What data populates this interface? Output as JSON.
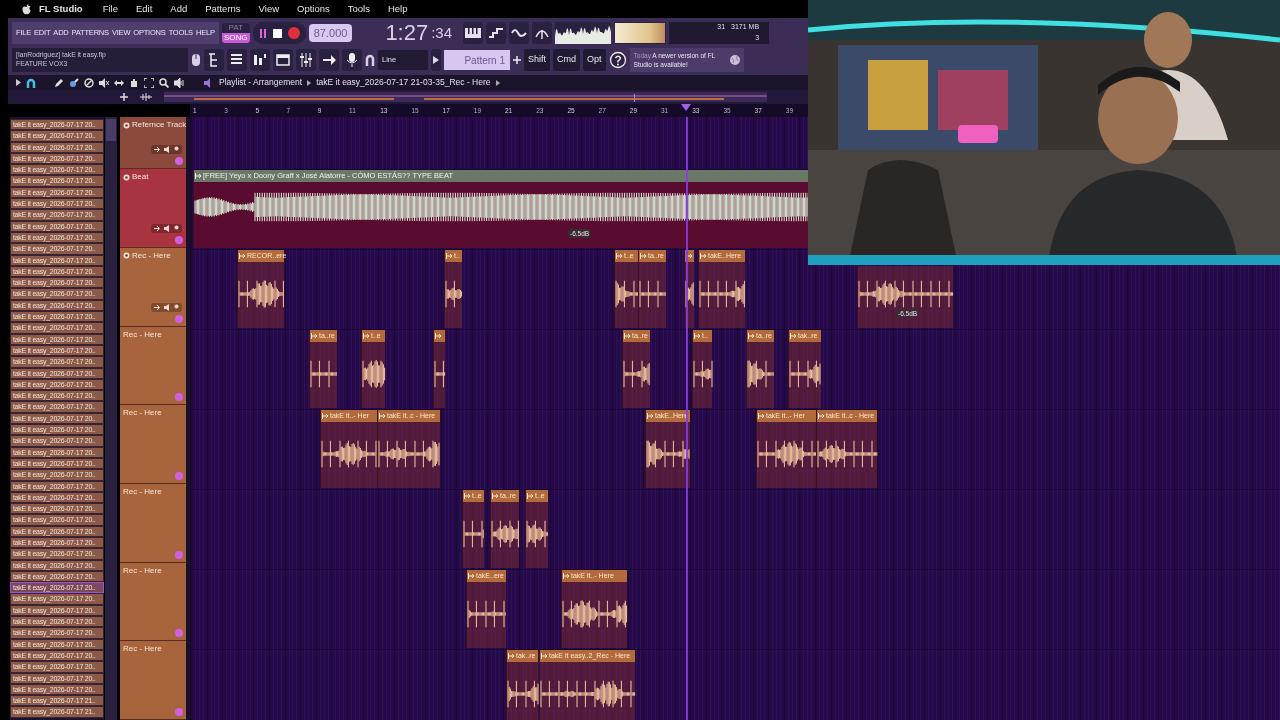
{
  "menubar": {
    "app": "FL Studio",
    "items": [
      "File",
      "Edit",
      "Add",
      "Patterns",
      "View",
      "Options",
      "Tools",
      "Help"
    ]
  },
  "toolbar": {
    "menus": [
      "FILE",
      "EDIT",
      "ADD",
      "PATTERNS",
      "VIEW",
      "OPTIONS",
      "TOOLS",
      "HELP"
    ],
    "modes": [
      {
        "label": "PAT",
        "selected": false
      },
      {
        "label": "SONG",
        "selected": true
      }
    ],
    "tempo": "87.000",
    "time_main": "1:27",
    "time_sub": ":34",
    "cpu": "31",
    "memory": "3171 MB",
    "polyphony": "3",
    "hint": [
      "[IanRodriguez] takE it easy.flp",
      "FEATURE VOX3"
    ],
    "snap": "Line",
    "pattern": "Pattern 1",
    "keys": [
      "Shift",
      "Cmd",
      "Opt"
    ],
    "news": {
      "date": "Today",
      "text": "A newer version of FL Studio is available!"
    }
  },
  "playlist": {
    "title": "Playlist - Arrangement",
    "path": "takE it easy_2026-07-17 21-03-35_Rec - Here",
    "ruler": [
      "1",
      "3",
      "5",
      "7",
      "9",
      "11",
      "13",
      "15",
      "17",
      "19",
      "21",
      "23",
      "25",
      "27",
      "29",
      "31",
      "33",
      "35",
      "37",
      "39"
    ],
    "browser": [
      {
        "text": "takE it easy_2026-07-17 20..",
        "selected": false
      },
      {
        "text": "takE it easy_2026-07-17 20..",
        "selected": false
      },
      {
        "text": "takE it easy_2026-07-17 20..",
        "selected": false
      },
      {
        "text": "takE it easy_2026-07-17 20..",
        "selected": false
      },
      {
        "text": "takE it easy_2026-07-17 20..",
        "selected": false
      },
      {
        "text": "takE it easy_2026-07-17 20..",
        "selected": false
      },
      {
        "text": "takE it easy_2026-07-17 20..",
        "selected": false
      },
      {
        "text": "takE it easy_2026-07-17 20..",
        "selected": false
      },
      {
        "text": "takE it easy_2026-07-17 20..",
        "selected": false
      },
      {
        "text": "takE it easy_2026-07-17 20..",
        "selected": false
      },
      {
        "text": "takE it easy_2026-07-17 20..",
        "selected": false
      },
      {
        "text": "takE it easy_2026-07-17 20..",
        "selected": false
      },
      {
        "text": "takE it easy_2026-07-17 20..",
        "selected": false
      },
      {
        "text": "takE it easy_2026-07-17 20..",
        "selected": false
      },
      {
        "text": "takE it easy_2026-07-17 20..",
        "selected": false
      },
      {
        "text": "takE it easy_2026-07-17 20..",
        "selected": false
      },
      {
        "text": "takE it easy_2026-07-17 20..",
        "selected": false
      },
      {
        "text": "takE it easy_2026-07-17 20..",
        "selected": false
      },
      {
        "text": "takE it easy_2026-07-17 20..",
        "selected": false
      },
      {
        "text": "takE it easy_2026-07-17 20..",
        "selected": false
      },
      {
        "text": "takE it easy_2026-07-17 20..",
        "selected": false
      },
      {
        "text": "takE it easy_2026-07-17 20..",
        "selected": false
      },
      {
        "text": "takE it easy_2026-07-17 20..",
        "selected": false
      },
      {
        "text": "takE it easy_2026-07-17 20..",
        "selected": false
      },
      {
        "text": "takE it easy_2026-07-17 20..",
        "selected": false
      },
      {
        "text": "takE it easy_2026-07-17 20..",
        "selected": false
      },
      {
        "text": "takE it easy_2026-07-17 20..",
        "selected": false
      },
      {
        "text": "takE it easy_2026-07-17 20..",
        "selected": false
      },
      {
        "text": "takE it easy_2026-07-17 20..",
        "selected": false
      },
      {
        "text": "takE it easy_2026-07-17 20..",
        "selected": false
      },
      {
        "text": "takE it easy_2026-07-17 20..",
        "selected": false
      },
      {
        "text": "takE it easy_2026-07-17 20..",
        "selected": false
      },
      {
        "text": "takE it easy_2026-07-17 20..",
        "selected": false
      },
      {
        "text": "takE it easy_2026-07-17 20..",
        "selected": false
      },
      {
        "text": "takE it easy_2026-07-17 20..",
        "selected": false
      },
      {
        "text": "takE it easy_2026-07-17 20..",
        "selected": false
      },
      {
        "text": "takE it easy_2026-07-17 20..",
        "selected": false
      },
      {
        "text": "takE it easy_2026-07-17 20..",
        "selected": false
      },
      {
        "text": "takE it easy_2026-07-17 20..",
        "selected": false
      },
      {
        "text": "takE it easy_2026-07-17 20..",
        "selected": false
      },
      {
        "text": "takE it easy_2026-07-17 20..",
        "selected": false
      },
      {
        "text": "takE it easy_2026-07-17 20..",
        "selected": true
      },
      {
        "text": "takE it easy_2026-07-17 20..",
        "selected": false
      },
      {
        "text": "takE it easy_2026-07-17 20..",
        "selected": false
      },
      {
        "text": "takE it easy_2026-07-17 20..",
        "selected": false
      },
      {
        "text": "takE it easy_2026-07-17 20..",
        "selected": false
      },
      {
        "text": "takE it easy_2026-07-17 20..",
        "selected": false
      },
      {
        "text": "takE it easy_2026-07-17 20..",
        "selected": false
      },
      {
        "text": "takE it easy_2026-07-17 20..",
        "selected": false
      },
      {
        "text": "takE it easy_2026-07-17 20..",
        "selected": false
      },
      {
        "text": "takE it easy_2026-07-17 20..",
        "selected": false
      },
      {
        "text": "takE it easy_2026-07-17 21..",
        "selected": false
      },
      {
        "text": "takE it easy_2026-07-17 21..",
        "selected": false
      }
    ],
    "tracks": [
      {
        "name": "Refernce Track",
        "color": "#8b4a3c",
        "controls": true
      },
      {
        "name": "Beat",
        "color": "#a8343f",
        "controls": true,
        "clips": [
          {
            "kind": "beat",
            "label": "[FREE] Yeyo x Doony Graff x José Alatorre - CÓMO ESTÁS??  TYPE BEAT",
            "gain": "-6.5dB"
          }
        ]
      },
      {
        "name": "Rec - Here",
        "color": "#a8643c",
        "controls": true,
        "clips": [
          {
            "kind": "rec",
            "label": "RECOR..ere"
          },
          {
            "kind": "rec",
            "label": "t.."
          },
          {
            "kind": "rec",
            "label": "t..e"
          },
          {
            "kind": "rec",
            "label": "ta..re"
          },
          {
            "kind": "rec"
          },
          {
            "kind": "rec",
            "label": "takE..Here"
          },
          {
            "kind": "rec",
            "gain": "-6.5dB"
          }
        ]
      },
      {
        "name": "Rec - Here",
        "color": "#a8643c",
        "controls": false,
        "clips": [
          {
            "kind": "rec",
            "label": "ta..re"
          },
          {
            "kind": "rec",
            "label": "t..e"
          },
          {
            "kind": "rec"
          },
          {
            "kind": "rec",
            "label": "ta..re"
          },
          {
            "kind": "rec",
            "label": "t.."
          },
          {
            "kind": "rec",
            "label": "ta..re"
          },
          {
            "kind": "rec",
            "label": "tak..re"
          }
        ]
      },
      {
        "name": "Rec - Here",
        "color": "#a8643c",
        "controls": false,
        "clips": [
          {
            "kind": "rec",
            "label": "takE it..- Her"
          },
          {
            "kind": "rec",
            "label": "takE it..c - Here"
          },
          {
            "kind": "rec",
            "label": "takE..Here"
          },
          {
            "kind": "rec",
            "label": "takE it..- Her"
          },
          {
            "kind": "rec",
            "label": "takE it..c - Here"
          }
        ]
      },
      {
        "name": "Rec - Here",
        "color": "#a8643c",
        "controls": false,
        "clips": [
          {
            "kind": "rec",
            "label": "t..e"
          },
          {
            "kind": "rec",
            "label": "ta..re"
          },
          {
            "kind": "rec",
            "label": "t..e"
          }
        ]
      },
      {
        "name": "Rec - Here",
        "color": "#a8643c",
        "controls": false,
        "clips": [
          {
            "kind": "rec",
            "label": "takE..ere"
          },
          {
            "kind": "rec",
            "label": "takE it..- Here"
          }
        ]
      },
      {
        "name": "Rec - Here",
        "color": "#a8643c",
        "controls": false,
        "clips": [
          {
            "kind": "rec",
            "label": "tak..re"
          },
          {
            "kind": "rec",
            "label": "takE it easy..2_Rec - Here"
          }
        ]
      }
    ]
  }
}
